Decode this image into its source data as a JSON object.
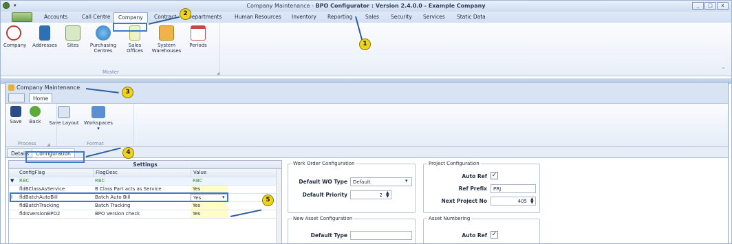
{
  "window": {
    "title_prefix": "Company Maintenance - ",
    "title_bold": "BPO Configurator : Version 2.4.0.0 - Example Company",
    "controls": [
      "_",
      "□",
      "x"
    ]
  },
  "main_tabs": [
    "Accounts",
    "Call Centre",
    "Company",
    "Contract",
    "Departments",
    "Human Resources",
    "Inventory",
    "Reporting",
    "Sales",
    "Security",
    "Services",
    "Static Data"
  ],
  "ribbon": {
    "buttons": [
      {
        "label": "Company",
        "icon": "compass-icon"
      },
      {
        "label": "Addresses",
        "icon": "book-icon"
      },
      {
        "label": "Sites",
        "icon": "map-icon"
      },
      {
        "label": "Purchasing Centres",
        "icon": "globe-icon"
      },
      {
        "label": "Sales Offices",
        "icon": "notepad-icon"
      },
      {
        "label": "System Warehouses",
        "icon": "warehouse-icon"
      },
      {
        "label": "Periods",
        "icon": "calendar-icon"
      }
    ],
    "group_label": "Master"
  },
  "doc": {
    "title": "Company Maintenance",
    "tab_home": "Home",
    "buttons": [
      "Save",
      "Back",
      "Save Layout",
      "Workspaces"
    ],
    "groups": [
      "Process",
      "Format"
    ],
    "subtabs": [
      "Details",
      "Configuration"
    ]
  },
  "grid": {
    "title": "Settings",
    "columns": [
      "ConfigFlag",
      "FlagDesc",
      "Value"
    ],
    "filter": "RBC",
    "rows": [
      {
        "flag": "fldBClassAsService",
        "desc": "B Class Part acts as Service",
        "value": "Yes"
      },
      {
        "flag": "fldBatchAutoBill",
        "desc": "Batch Auto Bill",
        "value": "Yes"
      },
      {
        "flag": "fldBatchTracking",
        "desc": "Batch Tracking",
        "value": "Yes"
      },
      {
        "flag": "fldIsVersionBPO2",
        "desc": "BPO Version check",
        "value": "Yes"
      }
    ]
  },
  "wo": {
    "title": "Work Order Configuration",
    "type_label": "Default WO Type",
    "type_value": "Default",
    "priority_label": "Default Priority",
    "priority_value": "2"
  },
  "project": {
    "title": "Project Configuration",
    "autoref_label": "Auto Ref",
    "prefix_label": "Ref Prefix",
    "prefix_value": "PRJ",
    "next_label": "Next Project No",
    "next_value": "405"
  },
  "asset": {
    "title": "New Asset Configuration",
    "type_label": "Default Type"
  },
  "numbering": {
    "title": "Asset Numbering",
    "autoref_label": "Auto Ref"
  },
  "callouts": [
    "1",
    "2",
    "3",
    "4",
    "5"
  ],
  "colors": {
    "accent": "#3a79c9",
    "callout": "#f2d31b"
  }
}
